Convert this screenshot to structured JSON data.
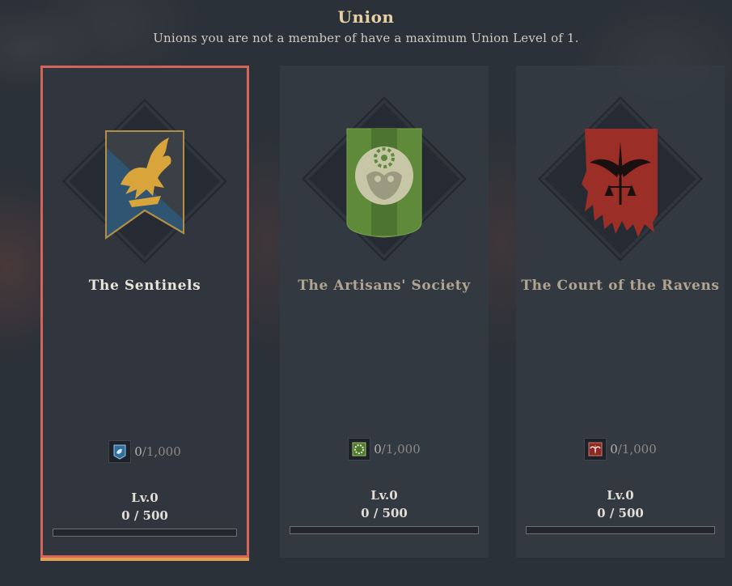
{
  "header": {
    "title": "Union",
    "subtitle": "Unions you are not a member of have a maximum Union Level of 1."
  },
  "unions": [
    {
      "name": "The Sentinels",
      "selected": true,
      "emblem_icon": "griffin-banner-icon",
      "reputation_icon": "sentinels-crest-icon",
      "reputation_current": "0",
      "reputation_max": "/1,000",
      "level": "Lv.0",
      "exp": "0 / 500",
      "exp_progress": 0
    },
    {
      "name": "The Artisans' Society",
      "selected": false,
      "emblem_icon": "owl-gear-banner-icon",
      "reputation_icon": "artisans-crest-icon",
      "reputation_current": "0",
      "reputation_max": "/1,000",
      "level": "Lv.0",
      "exp": "0 / 500",
      "exp_progress": 0
    },
    {
      "name": "The Court of the Ravens",
      "selected": false,
      "emblem_icon": "raven-banner-icon",
      "reputation_icon": "ravens-crest-icon",
      "reputation_current": "0",
      "reputation_max": "/1,000",
      "level": "Lv.0",
      "exp": "0 / 500",
      "exp_progress": 0
    }
  ],
  "colors": {
    "selected_border": "#d4655a",
    "selected_underline": "#e0a24e",
    "sentinels_banner": "#2f5572",
    "sentinels_gold": "#d9a53a",
    "artisans_banner": "#5f8a3a",
    "ravens_banner": "#9b2e26"
  }
}
